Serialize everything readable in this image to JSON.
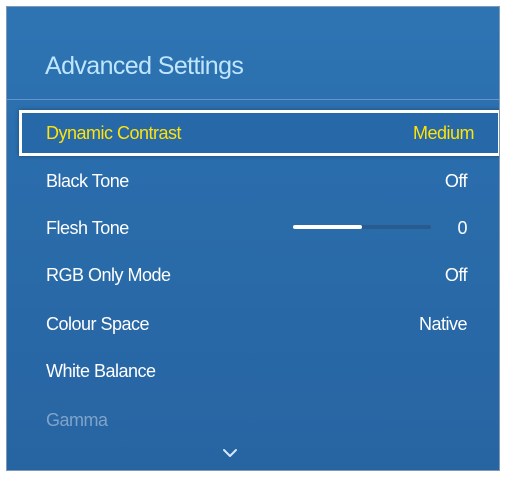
{
  "menu": {
    "title": "Advanced Settings",
    "items": [
      {
        "label": "Dynamic Contrast",
        "value": "Medium"
      },
      {
        "label": "Black Tone",
        "value": "Off"
      },
      {
        "label": "Flesh Tone",
        "value": "0"
      },
      {
        "label": "RGB Only Mode",
        "value": "Off"
      },
      {
        "label": "Colour Space",
        "value": "Native"
      },
      {
        "label": "White Balance",
        "value": ""
      },
      {
        "label": "Gamma",
        "value": ""
      }
    ],
    "flesh_tone_slider_fraction": 0.5,
    "scroll_indicator_icon": "chevron-down-icon"
  },
  "colors": {
    "panel_background": "#2a6cab",
    "title_text": "#bfe6ff",
    "focused_text": "#ffe30a",
    "focused_border": "#ffffff",
    "disabled_text": "#7fa4cb"
  }
}
